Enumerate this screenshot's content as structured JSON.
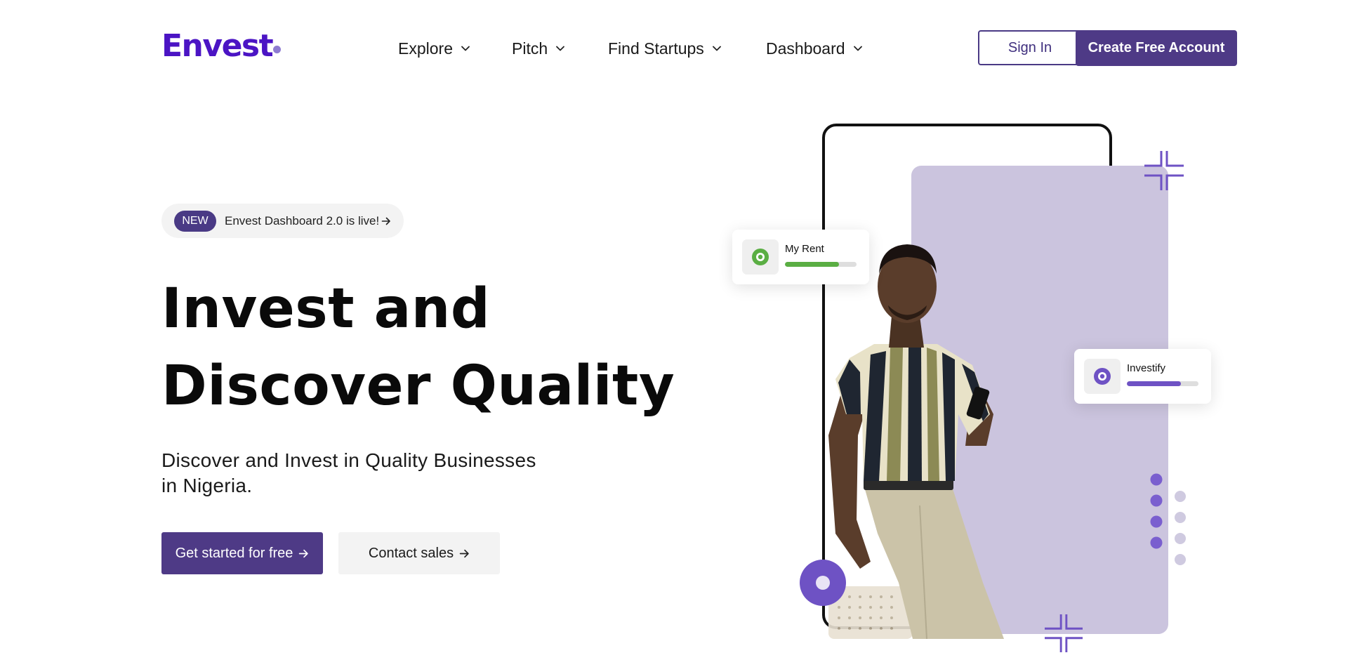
{
  "brand": {
    "logo_text": "Envest",
    "colors": {
      "primary": "#4e3a86",
      "logo": "#4b14c4",
      "accent": "#6e52c4",
      "card": "#cbc4de"
    }
  },
  "nav": {
    "items": [
      {
        "label": "Explore",
        "icon": "chevron-down-icon"
      },
      {
        "label": "Pitch",
        "icon": "chevron-down-icon"
      },
      {
        "label": "Find Startups",
        "icon": "chevron-down-icon"
      },
      {
        "label": "Dashboard",
        "icon": "chevron-down-icon"
      }
    ],
    "sign_in": "Sign In",
    "create_account": "Create Free Account"
  },
  "hero": {
    "announcement": {
      "badge": "NEW",
      "text": "Envest Dashboard 2.0 is live!",
      "icon": "arrow-right-icon"
    },
    "title_line1": "Invest and",
    "title_line2": "Discover Quality",
    "subtitle": "Discover and Invest in Quality Businesses in Nigeria.",
    "cta_primary": "Get started for free",
    "cta_secondary": "Contact sales"
  },
  "illustration": {
    "widgets": [
      {
        "label": "My Rent",
        "progress": 0.75,
        "color": "#5aae43",
        "icon": "target-icon"
      },
      {
        "label": "Investify",
        "progress": 0.75,
        "color": "#6e52c4",
        "icon": "target-icon"
      }
    ]
  }
}
